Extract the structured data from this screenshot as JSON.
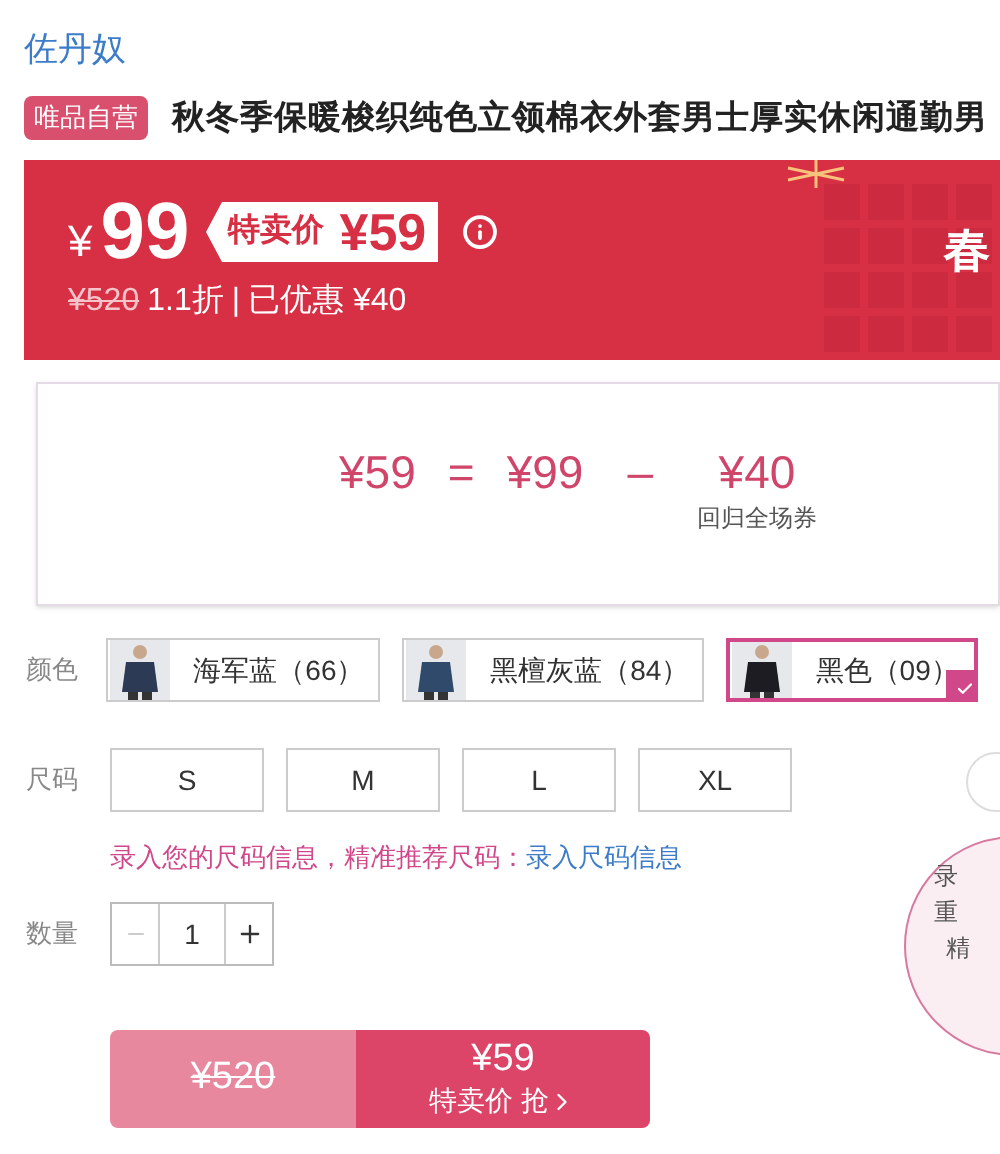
{
  "brand": "佐丹奴",
  "product": {
    "badge": "唯品自营",
    "title": "秋冬季保暖梭织纯色立领棉衣外套男士厚实休闲通勤男"
  },
  "price_banner": {
    "currency": "¥",
    "price": "99",
    "tag_label": "特卖价",
    "tag_price": "¥59",
    "original_price": "¥520",
    "discount": "1.1折",
    "separator": "|",
    "saved": "已优惠 ¥40",
    "promo": "春"
  },
  "price_popup": {
    "result": "¥59",
    "equals": "=",
    "base": "¥99",
    "minus": "–",
    "coupon": "¥40",
    "coupon_label": "回归全场券"
  },
  "color": {
    "label": "颜色",
    "options": [
      {
        "label": "海军蓝（66）",
        "selected": false
      },
      {
        "label": "黑檀灰蓝（84）",
        "selected": false
      },
      {
        "label": "黑色（09）",
        "selected": true
      }
    ]
  },
  "size": {
    "label": "尺码",
    "options": [
      {
        "label": "S",
        "selected": false
      },
      {
        "label": "M",
        "selected": false
      },
      {
        "label": "L",
        "selected": false
      },
      {
        "label": "XL",
        "selected": false
      }
    ]
  },
  "size_hint": {
    "text": "录入您的尺码信息，精准推荐尺码：",
    "link": "录入尺码信息"
  },
  "quantity": {
    "label": "数量",
    "value": "1",
    "minus_disabled": true
  },
  "buy": {
    "original_price": "¥520",
    "price": "¥59",
    "label": "特卖价 抢"
  },
  "size_bubble": {
    "lines": [
      "录",
      "重",
      "精"
    ]
  }
}
